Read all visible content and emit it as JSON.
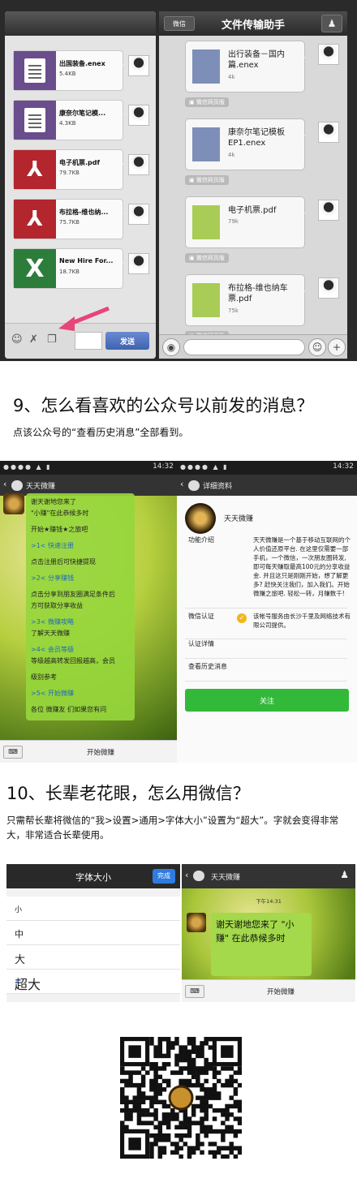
{
  "section1": {
    "left_panel": {
      "files": [
        {
          "name": "出国装备.enex",
          "size": "5.4KB",
          "type": "doc",
          "color": "#6a4d8c"
        },
        {
          "name": "康奈尔笔记模...",
          "size": "4.3KB",
          "type": "doc",
          "color": "#6a4d8c"
        },
        {
          "name": "电子机票.pdf",
          "size": "79.7KB",
          "type": "pdf",
          "color": "#b3262d"
        },
        {
          "name": "布拉格-维也纳...",
          "size": "75.7KB",
          "type": "pdf",
          "color": "#b3262d"
        },
        {
          "name": "New Hire For...",
          "size": "18.7KB",
          "type": "xls",
          "color": "#2c7d3a"
        }
      ],
      "send_label": "发送"
    },
    "right_panel": {
      "back_label": "微信",
      "title": "文件传输助手",
      "files": [
        {
          "name": "出行装备－国内篇.enex",
          "size": "4k",
          "type": "doc"
        },
        {
          "name": "康奈尔笔记模板EP1.enex",
          "size": "4k",
          "type": "doc"
        },
        {
          "name": "电子机票.pdf",
          "size": "79k",
          "type": "pdf"
        },
        {
          "name": "布拉格-维也纳车票.pdf",
          "size": "75k",
          "type": "pdf"
        }
      ],
      "web_tag": "微信网页版"
    }
  },
  "tip9": {
    "heading": "9、怎么看喜欢的公众号以前发的消息？",
    "sub": "点该公众号的“查看历史消息”全部看到。"
  },
  "section2": {
    "status_time": "14:32",
    "left": {
      "nav_title": "天天微赚",
      "messages": [
        "谢天谢地您来了",
        "\"小赚\"在此恭候多时",
        "开始★赚钱★之旅吧",
        ">1< 快速注册",
        "点击注册后可快捷提现",
        ">2< 分享赚钱",
        "点击分享到朋友圈满足条件后",
        "方可获取分享收益",
        ">3< 微赚攻略",
        "了解天天微赚",
        ">4< 会员等级",
        "等级越高转发回报越高，会员",
        "级别参考",
        ">5< 开始微赚",
        "各位 微赚友 们如果您有问"
      ],
      "bottom_label": "开始微赚"
    },
    "right": {
      "nav_title": "详细资料",
      "account_name": "天天微赚",
      "intro_label": "功能介绍",
      "intro_text": "天天微赚是一个基于移动互联网的个人价值还原平台. 在这里仅需要一部手机，一个微信，一次朋友圈转发, 即可每天赚取最高100元的分享收益金. 并且这只是刚刚开始，想了解更多? 赶快关注我们，加入我们。开始微赚之旅吧. 轻松一转，月赚数千!",
      "cert_label": "微信认证",
      "cert_text": "该帐号服务由长沙千里及网络技术有限公司提供。",
      "cert_detail": "认证详情",
      "history": "查看历史消息",
      "follow": "关注"
    }
  },
  "tip10": {
    "heading": "10、长辈老花眼，怎么用微信？",
    "sub": "只需帮长辈将微信的“我>设置>通用>字体大小”设置为“超大”。字就会变得非常大，非常适合长辈使用。"
  },
  "section3": {
    "font_panel": {
      "title": "字体大小",
      "done": "完成",
      "options": [
        "小",
        "中",
        "大",
        "超大"
      ],
      "selected": "超大"
    },
    "chat_panel": {
      "nav_title": "天天微赚",
      "time": "下午14:31",
      "message": "谢天谢地您来了 \"小赚\" 在此恭候多时",
      "bottom_label": "开始微赚"
    }
  }
}
